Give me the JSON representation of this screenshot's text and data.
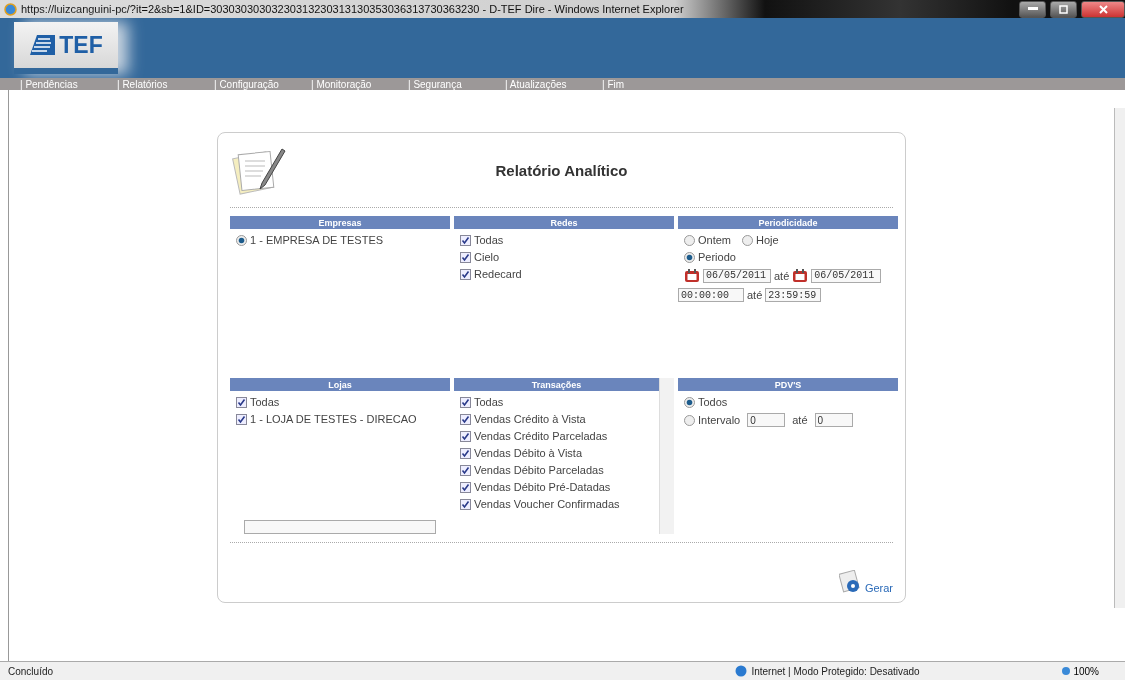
{
  "window": {
    "title": "https://luizcanguini-pc/?it=2&sb=1&ID=30303030303230313230313130353036313730363230 - D-TEF Dire - Windows Internet Explorer"
  },
  "logo": {
    "text": "TEF"
  },
  "nav": [
    "| Pendências",
    "| Relatórios",
    "| Configuração",
    "| Monitoração",
    "| Segurança",
    "| Atualizações",
    "| Fim"
  ],
  "report": {
    "title": "Relatório Analítico"
  },
  "empresas": {
    "title": "Empresas",
    "items": [
      {
        "label": "1 - EMPRESA DE TESTES",
        "selected": true
      }
    ]
  },
  "redes": {
    "title": "Redes",
    "items": [
      {
        "label": "Todas",
        "checked": true
      },
      {
        "label": "Cielo",
        "checked": true
      },
      {
        "label": "Redecard",
        "checked": true
      }
    ]
  },
  "periodicidade": {
    "title": "Periodicidade",
    "options": [
      {
        "label": "Ontem",
        "selected": false
      },
      {
        "label": "Hoje",
        "selected": false
      },
      {
        "label": "Periodo",
        "selected": true
      }
    ],
    "date_from": "06/05/2011",
    "date_sep": "até",
    "date_to": "06/05/2011",
    "time_from": "00:00:00",
    "time_sep": "até",
    "time_to": "23:59:59"
  },
  "lojas": {
    "title": "Lojas",
    "items": [
      {
        "label": "Todas",
        "checked": true
      },
      {
        "label": "1 - LOJA DE TESTES - DIRECAO",
        "checked": true
      }
    ]
  },
  "transacoes": {
    "title": "Transações",
    "items": [
      {
        "label": "Todas",
        "checked": true
      },
      {
        "label": "Vendas Crédito à Vista",
        "checked": true
      },
      {
        "label": "Vendas Crédito Parceladas",
        "checked": true
      },
      {
        "label": "Vendas Débito à Vista",
        "checked": true
      },
      {
        "label": "Vendas Débito Parceladas",
        "checked": true
      },
      {
        "label": "Vendas Débito Pré-Datadas",
        "checked": true
      },
      {
        "label": "Vendas Voucher Confirmadas",
        "checked": true
      }
    ]
  },
  "pdvs": {
    "title": "PDV'S",
    "options": [
      {
        "label": "Todos",
        "selected": true
      },
      {
        "label": "Intervalo",
        "selected": false
      }
    ],
    "from": "0",
    "sep": "até",
    "to": "0"
  },
  "gerar": {
    "label": "Gerar"
  },
  "status_bar": {
    "text": "Concluído",
    "zone": "Internet | Modo Protegido: Desativado",
    "zoom": "100%"
  }
}
